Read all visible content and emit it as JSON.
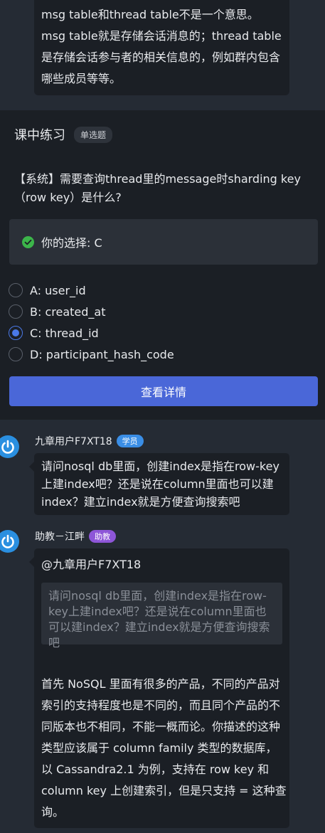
{
  "top_message": {
    "text": "msg table和thread table不是一个意思。msg table就是存储会话消息的；thread table是存储会话参与者的相关信息的，例如群内包含哪些成员等等。"
  },
  "quiz": {
    "title": "课中练习",
    "type_tag": "单选题",
    "question": "【系统】需要查询thread里的message时sharding key（row key）是什么?",
    "your_choice_label": "你的选择: C",
    "options": [
      {
        "label": "A:  user_id",
        "selected": false
      },
      {
        "label": "B:  created_at",
        "selected": false
      },
      {
        "label": "C:  thread_id",
        "selected": true
      },
      {
        "label": "D:  participant_hash_code",
        "selected": false
      }
    ],
    "detail_button": "查看详情",
    "accent_color": "#4a67d8",
    "correct_color": "#3cb54a"
  },
  "comments": [
    {
      "user": "九章用户F7XT18",
      "badge": "学员",
      "text": "请问nosql db里面，创建index是指在row-key上建index吧？还是说在column里面也可以建index？建立index就是方便查询搜索吧"
    },
    {
      "user": "助教－江畔",
      "badge": "助教",
      "mention": "@九章用户F7XT18",
      "quote": "请问nosql db里面，创建index是指在row-key上建index吧？还是说在column里面也可以建index？建立index就是方便查询搜索吧",
      "text": "首先 NoSQL 里面有很多的产品，不同的产品对索引的支持程度也是不同的，而且同个产品的不同版本也不相同，不能一概而论。你描述的这种类型应该属于 column family 类型的数据库，以 Cassandra2.1 为例，支持在 row key 和 column key 上创建索引，但是只支持 = 这种查询。"
    }
  ]
}
